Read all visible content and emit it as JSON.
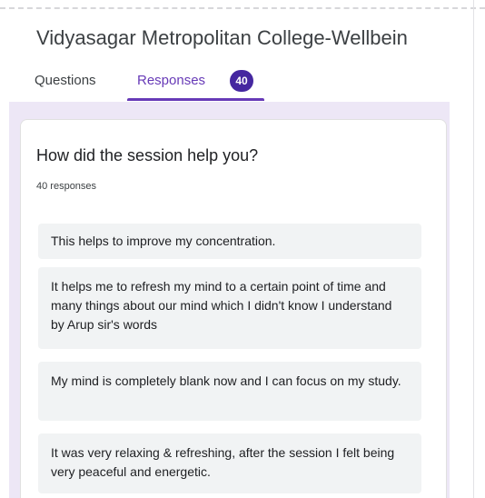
{
  "form": {
    "title": "Vidyasagar Metropolitan College-Wellbein"
  },
  "tabs": [
    {
      "label": "Questions"
    },
    {
      "label": "Responses",
      "count": "40"
    }
  ],
  "question": {
    "title": "How did the session help you?",
    "response_count": "40 responses",
    "responses": [
      "This helps to improve my concentration.",
      "It helps me to refresh my mind to a certain point of time and many things about our mind which I didn't know I understand by Arup sir's words",
      "My mind is completely blank now and I can focus on my study.",
      "It was very relaxing & refreshing, after the session I felt being very peaceful and energetic."
    ]
  },
  "colors": {
    "accent": "#673ab7",
    "badge": "#4527a0",
    "band": "#ede7f6",
    "response_bg": "#f1f3f4"
  }
}
